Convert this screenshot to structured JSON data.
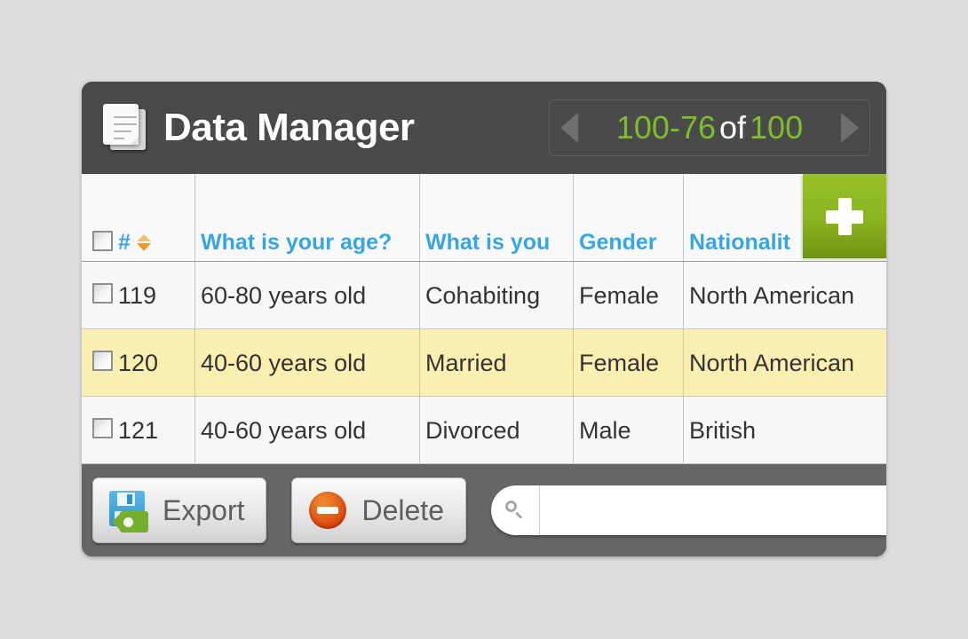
{
  "window": {
    "title": "Data Manager",
    "app_icon": "documents-stack-icon"
  },
  "pagination": {
    "range": "100-76",
    "of_label": "of",
    "total": "100",
    "prev_icon": "triangle-left-icon",
    "next_icon": "triangle-right-icon",
    "accent_color": "#7fbe2a"
  },
  "table": {
    "select_all_checkbox": "",
    "sort_column": "#",
    "sort_icon": "sort-updown-icon",
    "columns": [
      {
        "label": "#"
      },
      {
        "label": "What is your age?"
      },
      {
        "label": "What is you"
      },
      {
        "label": "Gender"
      },
      {
        "label": "Nationalit"
      }
    ],
    "rows": [
      {
        "id": "119",
        "age": "60-80 years old",
        "status": "Cohabiting",
        "gender": "Female",
        "nationality": "North American",
        "selected": false
      },
      {
        "id": "120",
        "age": "40-60 years old",
        "status": "Married",
        "gender": "Female",
        "nationality": "North American",
        "selected": true
      },
      {
        "id": "121",
        "age": "40-60 years old",
        "status": "Divorced",
        "gender": "Male",
        "nationality": "British",
        "selected": false
      }
    ],
    "add_button": {
      "label": "",
      "icon": "plus-icon",
      "color": "#8ab420"
    },
    "header_text_color": "#36a5e0",
    "selected_row_color": "#faeeb0"
  },
  "toolbar": {
    "export_label": "Export",
    "export_icon": "floppy-disk-export-icon",
    "delete_label": "Delete",
    "delete_icon": "red-minus-circle-icon",
    "search": {
      "value": "",
      "placeholder": "",
      "icon": "search-icon"
    }
  }
}
